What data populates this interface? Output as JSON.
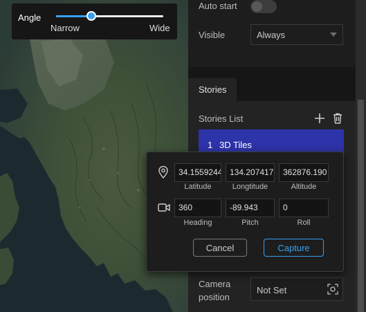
{
  "angle_control": {
    "label": "Angle",
    "min_label": "Narrow",
    "max_label": "Wide",
    "level": 0.33
  },
  "settings": {
    "auto_start_label": "Auto start",
    "auto_start_on": false,
    "visible_label": "Visible",
    "visible_value": "Always"
  },
  "tab": {
    "label": "Stories"
  },
  "stories": {
    "list_title": "Stories List",
    "items": [
      {
        "number": "1",
        "title": "3D Tiles"
      }
    ]
  },
  "camera": {
    "label": "Camera position",
    "value": "Not Set"
  },
  "capture_popup": {
    "latitude": {
      "value": "34.1559244",
      "label": "Latitude"
    },
    "longitude": {
      "value": "134.207417",
      "label": "Longtitude"
    },
    "altitude": {
      "value": "362876.190",
      "label": "Altitude"
    },
    "heading": {
      "value": "360",
      "label": "Heading"
    },
    "pitch": {
      "value": "-89.943",
      "label": "Pitch"
    },
    "roll": {
      "value": "0",
      "label": "Roll"
    },
    "cancel_label": "Cancel",
    "capture_label": "Capture"
  },
  "icons": {
    "add": "plus-icon",
    "delete": "trash-icon",
    "location": "map-pin-icon",
    "camera": "video-camera-icon",
    "capture_target": "camera-capture-icon"
  },
  "colors": {
    "accent": "#3aa0ef",
    "selected_item": "#2d33a8"
  }
}
